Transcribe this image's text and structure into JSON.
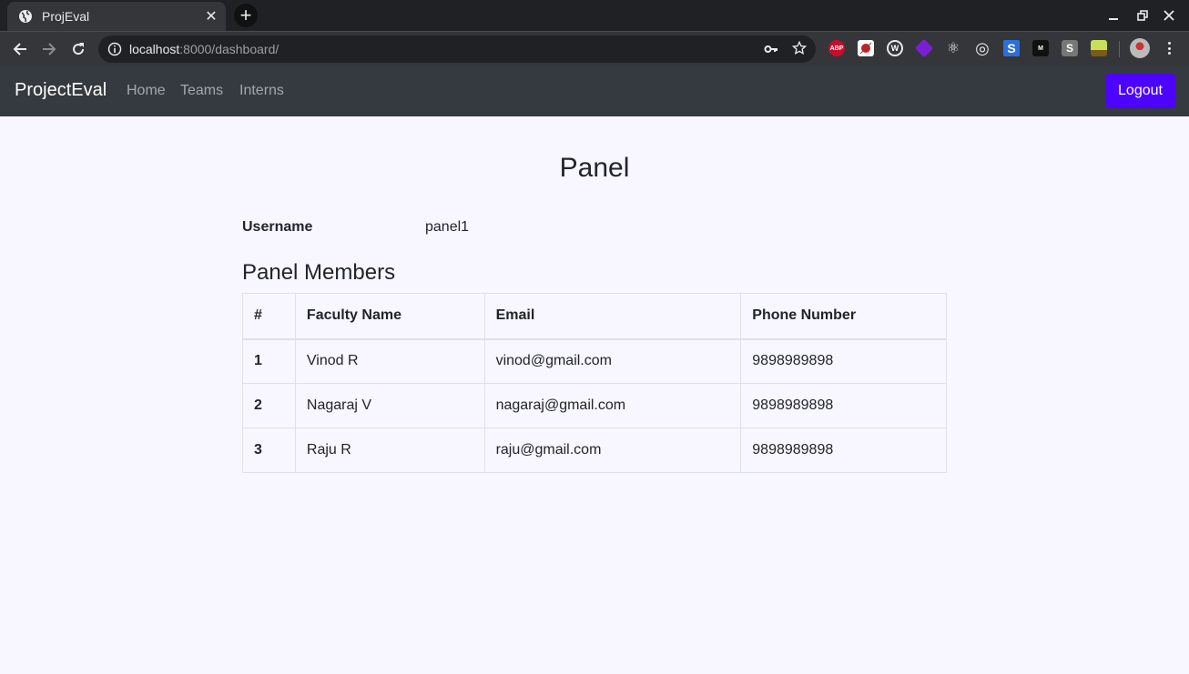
{
  "browser": {
    "tab_title": "ProjEval",
    "url_host": "localhost",
    "url_path": ":8000/dashboard/",
    "extensions": [
      {
        "name": "adblock-plus",
        "label": "ABP",
        "color": "#c70d2c"
      },
      {
        "name": "ladybug",
        "label": "",
        "color": "#ffffff"
      },
      {
        "name": "wappalyzer",
        "label": "W",
        "color": "#202124"
      },
      {
        "name": "purple-cube",
        "label": "",
        "color": "#7a1fd6"
      },
      {
        "name": "react-devtools",
        "label": "⚛",
        "color": "#35363a"
      },
      {
        "name": "target",
        "label": "◎",
        "color": "#35363a"
      },
      {
        "name": "s-blue",
        "label": "S",
        "color": "#2d6fd8"
      },
      {
        "name": "lock-m",
        "label": "M",
        "color": "#111111"
      },
      {
        "name": "s-gray",
        "label": "S",
        "color": "#777777"
      },
      {
        "name": "green-field",
        "label": "",
        "color": "#c6e05a"
      }
    ]
  },
  "navbar": {
    "brand": "ProjectEval",
    "links": [
      "Home",
      "Teams",
      "Interns"
    ],
    "logout_label": "Logout",
    "accent": "#4d04ff"
  },
  "main": {
    "title": "Panel",
    "username_label": "Username",
    "username_value": "panel1",
    "section_title": "Panel Members",
    "table": {
      "headers": [
        "#",
        "Faculty Name",
        "Email",
        "Phone Number"
      ],
      "rows": [
        [
          "1",
          "Vinod R",
          "vinod@gmail.com",
          "9898989898"
        ],
        [
          "2",
          "Nagaraj V",
          "nagaraj@gmail.com",
          "9898989898"
        ],
        [
          "3",
          "Raju R",
          "raju@gmail.com",
          "9898989898"
        ]
      ]
    }
  }
}
